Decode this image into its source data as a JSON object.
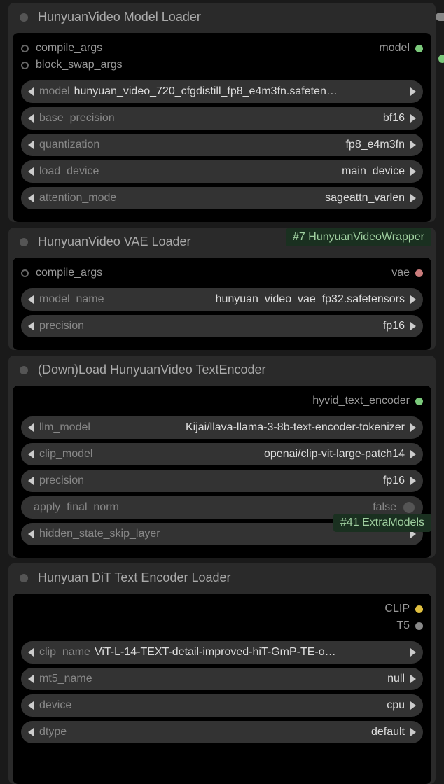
{
  "nodes": {
    "model_loader": {
      "title": "HunyuanVideo Model Loader",
      "inputs": {
        "compile_args": "compile_args",
        "block_swap_args": "block_swap_args"
      },
      "outputs": {
        "model": "model"
      },
      "widgets": {
        "model": {
          "label": "model",
          "value": "hunyuan_video_720_cfgdistill_fp8_e4m3fn.safeten…"
        },
        "base_precision": {
          "label": "base_precision",
          "value": "bf16"
        },
        "quantization": {
          "label": "quantization",
          "value": "fp8_e4m3fn"
        },
        "load_device": {
          "label": "load_device",
          "value": "main_device"
        },
        "attention_mode": {
          "label": "attention_mode",
          "value": "sageattn_varlen"
        }
      },
      "badge": "#7 HunyuanVideoWrapper"
    },
    "vae_loader": {
      "title": "HunyuanVideo VAE Loader",
      "inputs": {
        "compile_args": "compile_args"
      },
      "outputs": {
        "vae": "vae"
      },
      "widgets": {
        "model_name": {
          "label": "model_name",
          "value": "hunyuan_video_vae_fp32.safetensors"
        },
        "precision": {
          "label": "precision",
          "value": "fp16"
        }
      }
    },
    "text_encoder": {
      "title": "(Down)Load HunyuanVideo TextEncoder",
      "outputs": {
        "hyvid_text_encoder": "hyvid_text_encoder"
      },
      "widgets": {
        "llm_model": {
          "label": "llm_model",
          "value": "Kijai/llava-llama-3-8b-text-encoder-tokenizer"
        },
        "clip_model": {
          "label": "clip_model",
          "value": "openai/clip-vit-large-patch14"
        },
        "precision": {
          "label": "precision",
          "value": "fp16"
        },
        "apply_final_norm": {
          "label": "apply_final_norm",
          "value": "false"
        },
        "hidden_state_skip_layer": {
          "label": "hidden_state_skip_layer",
          "value": ""
        }
      },
      "badge": "#41 ExtraModels"
    },
    "dit_encoder": {
      "title": "Hunyuan DiT Text Encoder Loader",
      "outputs": {
        "clip": "CLIP",
        "t5": "T5"
      },
      "widgets": {
        "clip_name": {
          "label": "clip_name",
          "value": "ViT-L-14-TEXT-detail-improved-hiT-GmP-TE-o…"
        },
        "mt5_name": {
          "label": "mt5_name",
          "value": "null"
        },
        "device": {
          "label": "device",
          "value": "cpu"
        },
        "dtype": {
          "label": "dtype",
          "value": "default"
        }
      }
    }
  }
}
